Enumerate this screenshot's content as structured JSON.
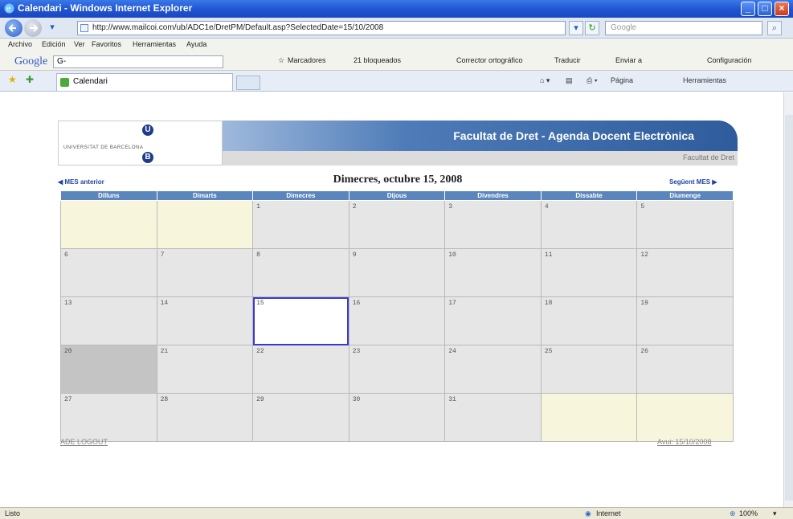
{
  "window": {
    "title": "Calendari - Windows Internet Explorer"
  },
  "address": {
    "url": "http://www.mailcoi.com/ub/ADC1e/DretPM/Default.asp?SelectedDate=15/10/2008",
    "search_placeholder": "Google"
  },
  "menu": {
    "items": [
      "Archivo",
      "Edición",
      "Ver",
      "Favoritos",
      "Herramientas",
      "Ayuda"
    ]
  },
  "google_toolbar": {
    "brand": "Google",
    "box_value": "G-",
    "marcadores": "Marcadores",
    "blocked": "21 bloqueados",
    "spell": "Corrector ortográfico",
    "translate": "Traducir",
    "send": "Enviar a",
    "config": "Configuración"
  },
  "tabs": {
    "active_tab": "Calendari",
    "page_menu": "Página",
    "tools_menu": "Herramientas"
  },
  "banner": {
    "university": "UNIVERSITAT DE BARCELONA",
    "logo_letter_top": "U",
    "logo_letter_bottom": "B",
    "title": "Facultat de Dret - Agenda Docent Electrònica",
    "faculty_link": "Facultat de Dret"
  },
  "calendar": {
    "prev_label": "MES anterior",
    "next_label": "Següent MES",
    "heading": "Dimecres, octubre 15, 2008",
    "weekdays": [
      "Dilluns",
      "Dimarts",
      "Dimecres",
      "Dijous",
      "Divendres",
      "Dissabte",
      "Diumenge"
    ],
    "weeks": [
      [
        "",
        "",
        "1",
        "2",
        "3",
        "4",
        "5"
      ],
      [
        "6",
        "7",
        "8",
        "9",
        "10",
        "11",
        "12"
      ],
      [
        "13",
        "14",
        "15",
        "16",
        "17",
        "18",
        "19"
      ],
      [
        "20",
        "21",
        "22",
        "23",
        "24",
        "25",
        "26"
      ],
      [
        "27",
        "28",
        "29",
        "30",
        "31",
        "",
        ""
      ]
    ],
    "selected_day": "15",
    "shaded_day": "20"
  },
  "footer": {
    "logout": "ADE LOGOUT",
    "today": "Avui: 15/10/2008"
  },
  "status": {
    "left": "Listo",
    "zone": "Internet",
    "zoom": "100%"
  },
  "colors": {
    "header_blue": "#5a86bd",
    "selected_outline": "#3a3acf",
    "empty_cell": "#f8f5dd"
  }
}
